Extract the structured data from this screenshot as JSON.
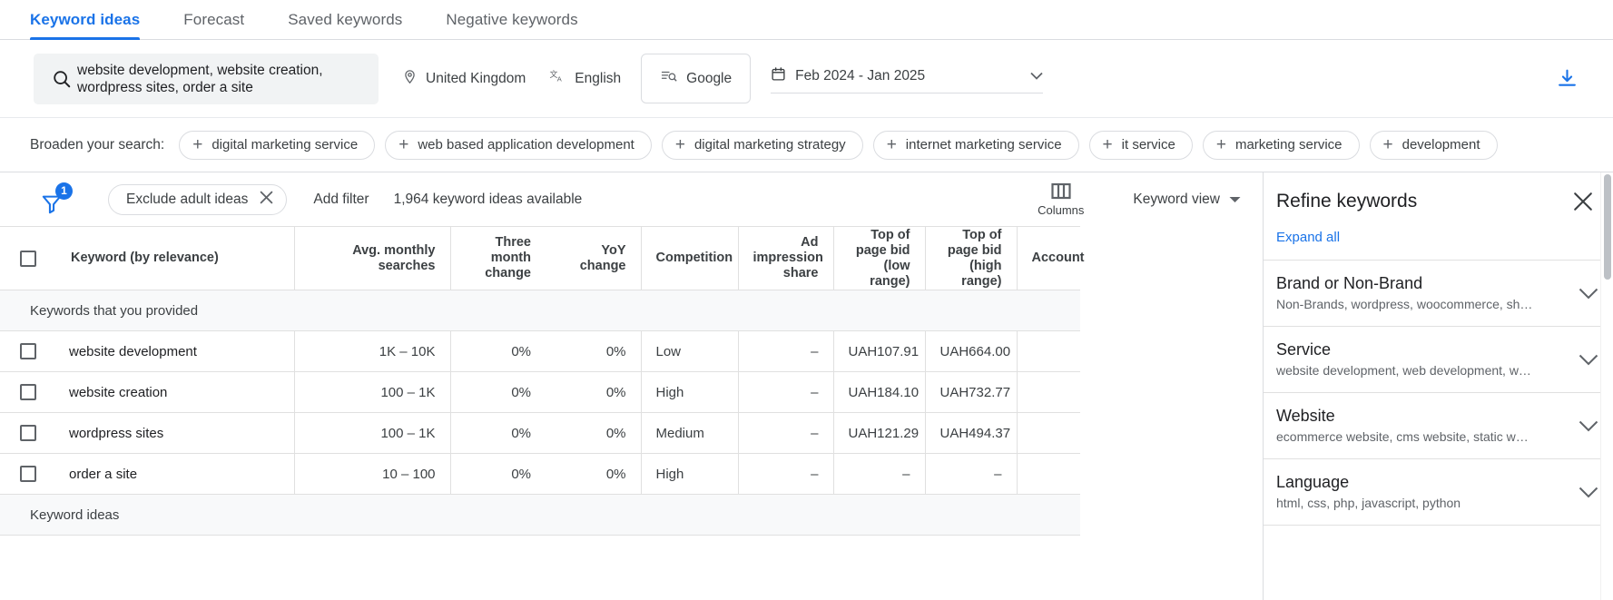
{
  "tabs": [
    {
      "label": "Keyword ideas",
      "active": true
    },
    {
      "label": "Forecast",
      "active": false
    },
    {
      "label": "Saved keywords",
      "active": false
    },
    {
      "label": "Negative keywords",
      "active": false
    }
  ],
  "search": {
    "query": "website development, website creation,\nwordpress sites, order a site",
    "location": "United Kingdom",
    "language": "English",
    "network": "Google",
    "date_range": "Feb 2024 - Jan 2025"
  },
  "broaden": {
    "label": "Broaden your search:",
    "chips": [
      "digital marketing service",
      "web based application development",
      "digital marketing strategy",
      "internet marketing service",
      "it service",
      "marketing service",
      "development"
    ]
  },
  "filterbar": {
    "filter_count": "1",
    "active_filter": "Exclude adult ideas",
    "add_filter": "Add filter",
    "idea_count": "1,964 keyword ideas available",
    "columns_label": "Columns",
    "view_label": "Keyword view"
  },
  "table": {
    "columns": [
      "Keyword (by relevance)",
      "Avg. monthly searches",
      "Three month change",
      "YoY change",
      "Competition",
      "Ad impression share",
      "Top of page bid (low range)",
      "Top of page bid (high range)",
      "Account"
    ],
    "group_label": "Keywords that you provided",
    "rows": [
      {
        "keyword": "website development",
        "avg_monthly_searches": "1K – 10K",
        "three_month_change": "0%",
        "yoy_change": "0%",
        "competition": "Low",
        "ad_impression_share": "–",
        "bid_low": "UAH107.91",
        "bid_high": "UAH664.00",
        "account": ""
      },
      {
        "keyword": "website creation",
        "avg_monthly_searches": "100 – 1K",
        "three_month_change": "0%",
        "yoy_change": "0%",
        "competition": "High",
        "ad_impression_share": "–",
        "bid_low": "UAH184.10",
        "bid_high": "UAH732.77",
        "account": ""
      },
      {
        "keyword": "wordpress sites",
        "avg_monthly_searches": "100 – 1K",
        "three_month_change": "0%",
        "yoy_change": "0%",
        "competition": "Medium",
        "ad_impression_share": "–",
        "bid_low": "UAH121.29",
        "bid_high": "UAH494.37",
        "account": ""
      },
      {
        "keyword": "order a site",
        "avg_monthly_searches": "10 – 100",
        "three_month_change": "0%",
        "yoy_change": "0%",
        "competition": "High",
        "ad_impression_share": "–",
        "bid_low": "–",
        "bid_high": "–",
        "account": ""
      }
    ],
    "group_label_2": "Keyword ideas"
  },
  "refine": {
    "title": "Refine keywords",
    "expand_all": "Expand all",
    "groups": [
      {
        "title": "Brand or Non-Brand",
        "subtitle": "Non-Brands, wordpress, woocommerce, sh…"
      },
      {
        "title": "Service",
        "subtitle": "website development, web development, w…"
      },
      {
        "title": "Website",
        "subtitle": "ecommerce website, cms website, static w…"
      },
      {
        "title": "Language",
        "subtitle": "html, css, php, javascript, python"
      }
    ]
  },
  "colors": {
    "accent": "#1a73e8",
    "text_primary": "#202124",
    "text_secondary": "#5f6368",
    "border": "#dadce0",
    "surface_alt": "#f1f3f4"
  }
}
